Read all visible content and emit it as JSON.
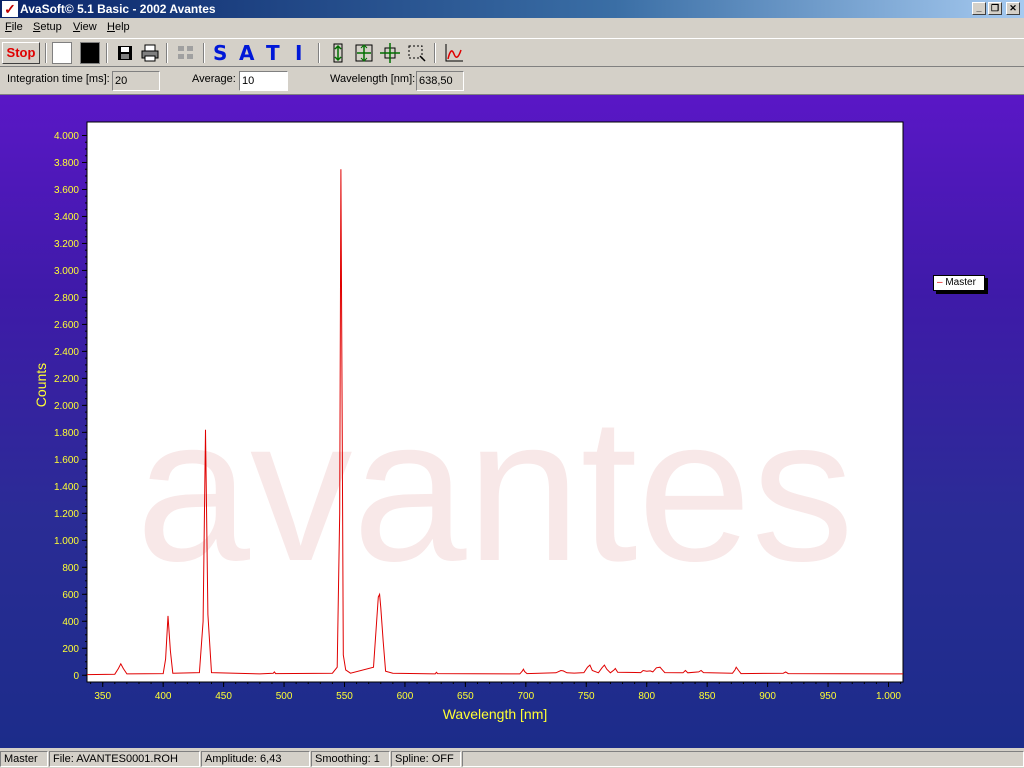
{
  "window": {
    "title": "AvaSoft© 5.1 Basic - 2002 Avantes",
    "app_icon": "avantes-check-icon"
  },
  "menu": [
    {
      "label": "File",
      "key": "F",
      "rest": "ile"
    },
    {
      "label": "Setup",
      "key": "S",
      "rest": "etup"
    },
    {
      "label": "View",
      "key": "V",
      "rest": "iew"
    },
    {
      "label": "Help",
      "key": "H",
      "rest": "elp"
    }
  ],
  "toolbar": {
    "stop_label": "Stop",
    "sati": [
      "S",
      "A",
      "T",
      "I"
    ],
    "colors": {
      "stop": "#e00000",
      "sati": "#0018d8",
      "white_swatch": "#ffffff",
      "black_swatch": "#000000"
    }
  },
  "params": {
    "integration_label": "Integration time [ms]:",
    "integration_value": "20",
    "average_label": "Average:",
    "average_value": "10",
    "wavelength_label": "Wavelength [nm]:",
    "wavelength_value": "638,50"
  },
  "status": {
    "master": "Master",
    "file": "File: AVANTES0001.ROH",
    "amplitude": "Amplitude: 6,43",
    "smoothing": "Smoothing: 1",
    "spline": "Spline: OFF"
  },
  "chart_data": {
    "type": "line",
    "xlabel": "Wavelength [nm]",
    "ylabel": "Counts",
    "watermark": "avantes",
    "xlim": [
      337,
      1012
    ],
    "ylim": [
      -50,
      4100
    ],
    "x_ticks": [
      350,
      400,
      450,
      500,
      550,
      600,
      650,
      700,
      750,
      800,
      850,
      900,
      950,
      1000
    ],
    "x_tick_labels": [
      "350",
      "400",
      "450",
      "500",
      "550",
      "600",
      "650",
      "700",
      "750",
      "800",
      "850",
      "900",
      "950",
      "1.000"
    ],
    "y_ticks": [
      0,
      200,
      400,
      600,
      800,
      1000,
      1200,
      1400,
      1600,
      1800,
      2000,
      2200,
      2400,
      2600,
      2800,
      3000,
      3200,
      3400,
      3600,
      3800,
      4000
    ],
    "y_tick_labels": [
      "0",
      "200",
      "400",
      "600",
      "800",
      "1.000",
      "1.200",
      "1.400",
      "1.600",
      "1.800",
      "2.000",
      "2.200",
      "2.400",
      "2.600",
      "2.800",
      "3.000",
      "3.200",
      "3.400",
      "3.600",
      "3.800",
      "4.000"
    ],
    "series": [
      {
        "name": "Master",
        "color": "#e00000",
        "x": [
          337,
          360,
          363,
          365,
          367,
          370,
          400,
          402,
          404,
          406,
          408,
          430,
          433,
          435,
          437,
          440,
          480,
          491,
          492,
          493,
          540,
          544,
          546,
          547,
          548,
          549,
          551,
          555,
          574,
          576,
          578,
          579,
          580,
          582,
          584,
          590,
          625,
          626,
          627,
          695,
          697,
          698,
          699,
          701,
          725,
          729,
          731,
          734,
          740,
          748,
          751,
          753,
          755,
          760,
          763,
          765,
          767,
          770,
          773,
          774,
          776,
          795,
          797,
          800,
          803,
          805,
          808,
          811,
          813,
          815,
          830,
          832,
          834,
          843,
          845,
          847,
          871,
          873,
          874,
          876,
          878,
          913,
          915,
          917,
          1012
        ],
        "y": [
          5,
          8,
          50,
          85,
          50,
          10,
          12,
          120,
          440,
          180,
          15,
          20,
          400,
          1820,
          450,
          20,
          10,
          15,
          25,
          12,
          15,
          60,
          1200,
          3750,
          2000,
          150,
          40,
          15,
          60,
          320,
          580,
          600,
          500,
          250,
          30,
          15,
          10,
          22,
          12,
          10,
          30,
          45,
          28,
          12,
          18,
          35,
          32,
          18,
          16,
          20,
          60,
          75,
          35,
          18,
          55,
          75,
          45,
          18,
          40,
          50,
          22,
          20,
          35,
          30,
          32,
          25,
          55,
          60,
          40,
          20,
          18,
          35,
          18,
          25,
          35,
          20,
          15,
          40,
          60,
          35,
          12,
          15,
          25,
          12,
          10
        ]
      }
    ]
  }
}
